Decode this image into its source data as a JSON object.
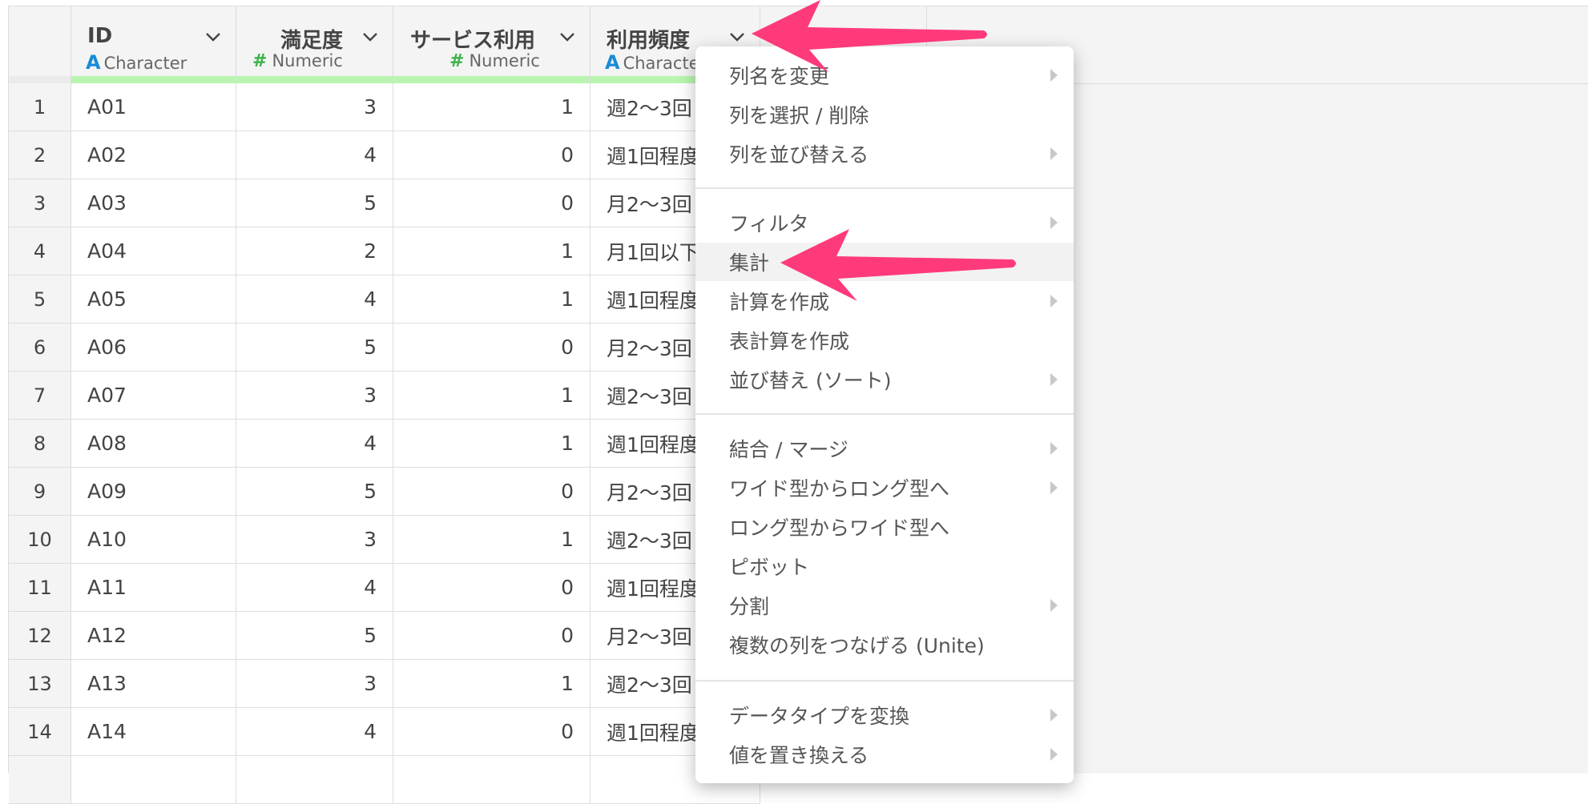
{
  "columns": [
    {
      "name": "ID",
      "type_label": "Character",
      "type_icon": "A"
    },
    {
      "name": "満足度",
      "type_label": "Numeric",
      "type_icon": "#"
    },
    {
      "name": "サービス利用",
      "type_label": "Numeric",
      "type_icon": "#"
    },
    {
      "name": "利用頻度",
      "type_label": "Character",
      "type_icon": "A"
    }
  ],
  "rows": [
    {
      "n": "1",
      "id": "A01",
      "satisfaction": "3",
      "service": "1",
      "freq": "週2〜3回"
    },
    {
      "n": "2",
      "id": "A02",
      "satisfaction": "4",
      "service": "0",
      "freq": "週1回程度"
    },
    {
      "n": "3",
      "id": "A03",
      "satisfaction": "5",
      "service": "0",
      "freq": "月2〜3回"
    },
    {
      "n": "4",
      "id": "A04",
      "satisfaction": "2",
      "service": "1",
      "freq": "月1回以下"
    },
    {
      "n": "5",
      "id": "A05",
      "satisfaction": "4",
      "service": "1",
      "freq": "週1回程度"
    },
    {
      "n": "6",
      "id": "A06",
      "satisfaction": "5",
      "service": "0",
      "freq": "月2〜3回"
    },
    {
      "n": "7",
      "id": "A07",
      "satisfaction": "3",
      "service": "1",
      "freq": "週2〜3回"
    },
    {
      "n": "8",
      "id": "A08",
      "satisfaction": "4",
      "service": "1",
      "freq": "週1回程度"
    },
    {
      "n": "9",
      "id": "A09",
      "satisfaction": "5",
      "service": "0",
      "freq": "月2〜3回"
    },
    {
      "n": "10",
      "id": "A10",
      "satisfaction": "3",
      "service": "1",
      "freq": "週2〜3回"
    },
    {
      "n": "11",
      "id": "A11",
      "satisfaction": "4",
      "service": "0",
      "freq": "週1回程度"
    },
    {
      "n": "12",
      "id": "A12",
      "satisfaction": "5",
      "service": "0",
      "freq": "月2〜3回"
    },
    {
      "n": "13",
      "id": "A13",
      "satisfaction": "3",
      "service": "1",
      "freq": "週2〜3回"
    },
    {
      "n": "14",
      "id": "A14",
      "satisfaction": "4",
      "service": "0",
      "freq": "週1回程度"
    }
  ],
  "menu": {
    "items": [
      {
        "label": "列名を変更",
        "submenu": true
      },
      {
        "label": "列を選択 / 削除",
        "submenu": false
      },
      {
        "label": "列を並び替える",
        "submenu": true
      },
      {
        "label": "フィルタ",
        "submenu": true
      },
      {
        "label": "集計",
        "submenu": false,
        "highlighted": true
      },
      {
        "label": "計算を作成",
        "submenu": true
      },
      {
        "label": "表計算を作成",
        "submenu": false
      },
      {
        "label": "並び替え (ソート)",
        "submenu": true
      },
      {
        "label": "結合 / マージ",
        "submenu": true
      },
      {
        "label": "ワイド型からロング型へ",
        "submenu": true
      },
      {
        "label": "ロング型からワイド型へ",
        "submenu": false
      },
      {
        "label": "ピボット",
        "submenu": false
      },
      {
        "label": "分割",
        "submenu": true
      },
      {
        "label": "複数の列をつなげる (Unite)",
        "submenu": false
      },
      {
        "label": "データタイプを変換",
        "submenu": true
      },
      {
        "label": "値を置き換える",
        "submenu": true
      }
    ]
  },
  "colors": {
    "pointer": "#ff3a7a",
    "character_icon": "#1a8bd6",
    "numeric_icon": "#3cb24a",
    "quality_bar": "#b9f5b0"
  }
}
